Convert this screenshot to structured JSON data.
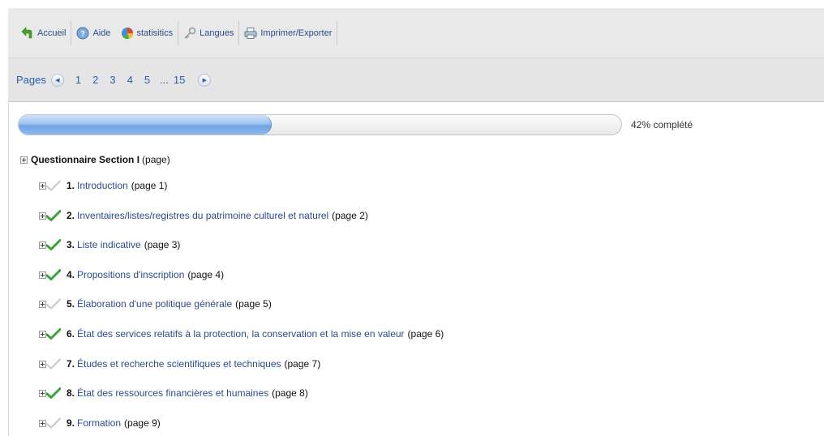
{
  "toolbar": {
    "items": [
      {
        "label": "Accueil",
        "icon": "home-arrow-icon"
      },
      {
        "label": "Aide",
        "icon": "help-globe-icon"
      },
      {
        "label": "statisitics",
        "icon": "stats-globe-icon"
      },
      {
        "label": "Langues",
        "icon": "key-icon"
      },
      {
        "label": "Imprimer/Exporter",
        "icon": "printer-icon"
      }
    ]
  },
  "pager": {
    "label": "Pages",
    "pages": [
      "1",
      "2",
      "3",
      "4",
      "5",
      "...",
      "15"
    ]
  },
  "progress": {
    "percent": 42,
    "text": "42% complété"
  },
  "tree": {
    "root_title": "Questionnaire Section I",
    "root_suffix": "(page)",
    "items": [
      {
        "num": "1.",
        "label": "Introduction",
        "page": "(page 1)",
        "done": false
      },
      {
        "num": "2.",
        "label": "Inventaires/listes/registres du patrimoine culturel et naturel",
        "page": "(page 2)",
        "done": true
      },
      {
        "num": "3.",
        "label": "Liste indicative",
        "page": "(page 3)",
        "done": true
      },
      {
        "num": "4.",
        "label": "Propositions d'inscription",
        "page": "(page 4)",
        "done": true
      },
      {
        "num": "5.",
        "label": "Élaboration d'une politique générale",
        "page": "(page 5)",
        "done": false
      },
      {
        "num": "6.",
        "label": "État des services relatifs à la protection, la conservation et la mise en valeur",
        "page": "(page 6)",
        "done": true
      },
      {
        "num": "7.",
        "label": "Études et recherche scientifiques et techniques",
        "page": "(page 7)",
        "done": false
      },
      {
        "num": "8.",
        "label": "État des ressources financières et humaines",
        "page": "(page 8)",
        "done": true
      },
      {
        "num": "9.",
        "label": "Formation",
        "page": "(page 9)",
        "done": false
      }
    ]
  },
  "colors": {
    "link": "#2a4c8c",
    "check_done": "#3aa33a",
    "check_pending": "#c8c8c8"
  }
}
